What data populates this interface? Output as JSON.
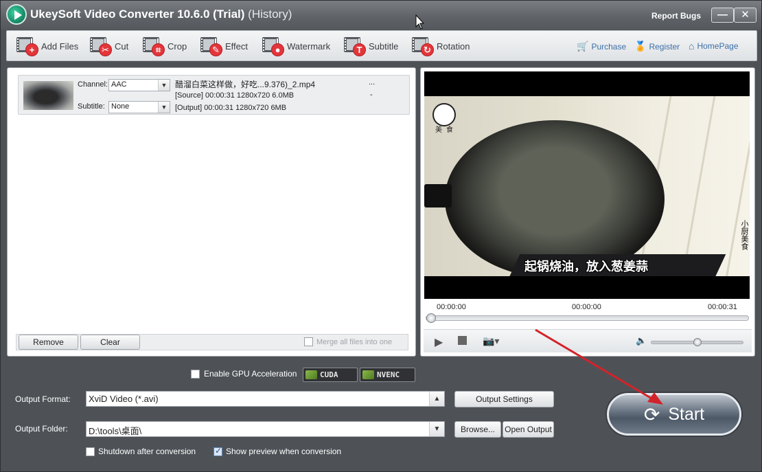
{
  "window": {
    "title": "UkeySoft Video Converter 10.6.0 (Trial)",
    "title_suffix": "(History)",
    "report_bugs": "Report Bugs",
    "minimize_label": "—",
    "close_label": "✕"
  },
  "toolbar": {
    "add_files": "Add Files",
    "cut": "Cut",
    "crop": "Crop",
    "effect": "Effect",
    "watermark": "Watermark",
    "subtitle": "Subtitle",
    "rotation": "Rotation",
    "purchase": "Purchase",
    "register": "Register",
    "homepage": "HomePage"
  },
  "file_list": {
    "items": [
      {
        "channel_label": "Channel:",
        "channel_value": "AAC",
        "subtitle_label": "Subtitle:",
        "subtitle_value": "None",
        "filename": "醋溜白菜这样做，好吃...9.376)_2.mp4",
        "more": "...",
        "dash": "-",
        "source": "[Source]  00:00:31  1280x720  6.0MB",
        "output": "[Output]  00:00:31  1280x720  6MB"
      }
    ],
    "remove": "Remove",
    "clear": "Clear",
    "merge": "Merge all files into one"
  },
  "preview": {
    "caption": "起锅烧油，放入葱姜蒜",
    "watermark_small": "美食",
    "watermark_vertical": "小厨美食",
    "time_start": "00:00:00",
    "time_current": "00:00:00",
    "time_end": "00:00:31",
    "seek_fraction": 0.0,
    "volume_fraction": 0.5
  },
  "settings": {
    "gpu_label": "Enable GPU Acceleration",
    "cuda": "CUDA",
    "nvenc": "NVENC",
    "output_format_label": "Output Format:",
    "output_format_value": "XviD Video (*.avi)",
    "output_settings": "Output Settings",
    "output_folder_label": "Output Folder:",
    "output_folder_value": "D:\\tools\\桌面\\",
    "browse": "Browse...",
    "open_output": "Open Output",
    "shutdown": "Shutdown after conversion",
    "show_preview": "Show preview when conversion",
    "shutdown_checked": false,
    "show_preview_checked": true
  },
  "start": "Start",
  "colors": {
    "accent_red": "#e2363b",
    "arrow_red": "#d3232a",
    "link_blue": "#3d6fa8"
  }
}
